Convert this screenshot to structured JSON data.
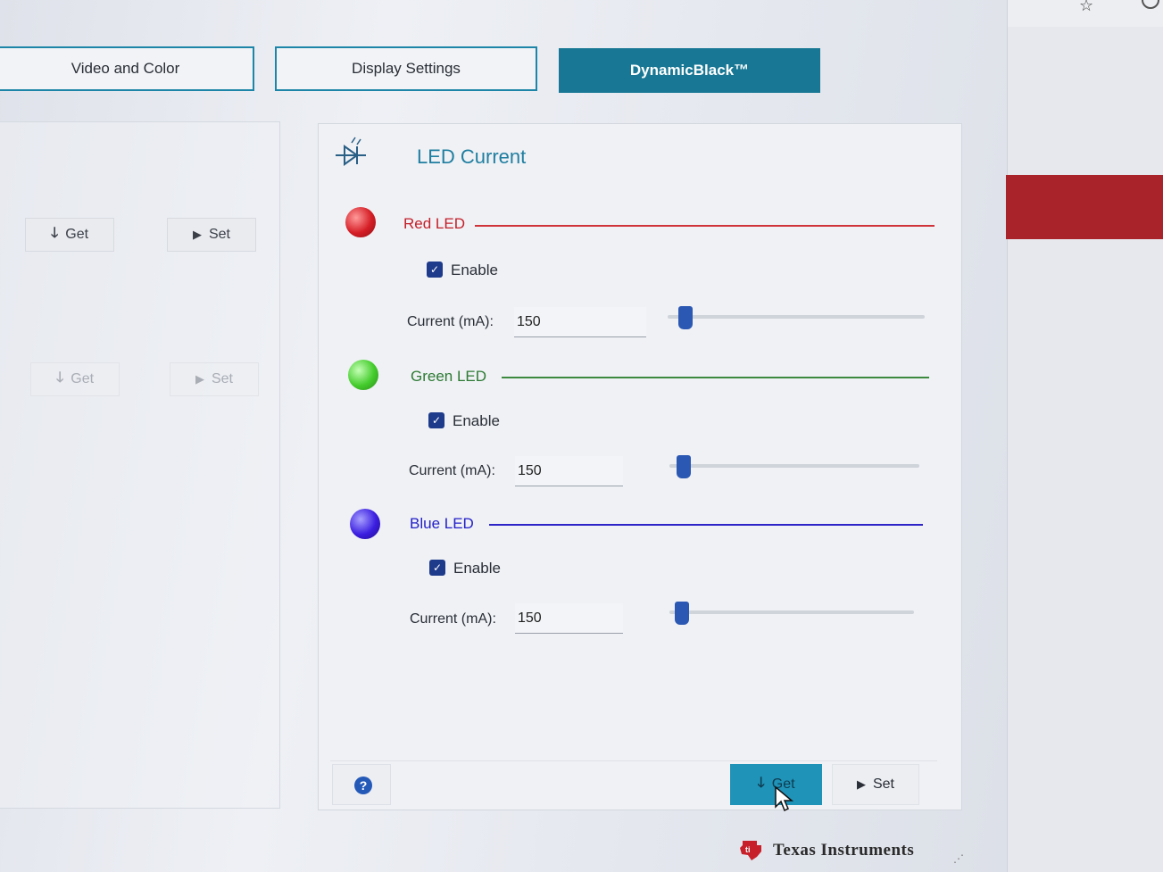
{
  "tabs": [
    {
      "label": "Video and Color",
      "active": false
    },
    {
      "label": "Display Settings",
      "active": false
    },
    {
      "label": "DynamicBlack™",
      "active": true
    }
  ],
  "left_panel": {
    "buttons": [
      {
        "label": "Get",
        "icon": "arrow-down-icon"
      },
      {
        "label": "Set",
        "icon": "play-icon"
      },
      {
        "label": "Get",
        "icon": "arrow-down-icon",
        "disabled": true
      },
      {
        "label": "Set",
        "icon": "play-icon",
        "disabled": true
      }
    ]
  },
  "led_panel": {
    "title": "LED Current",
    "title_icon": "led-diode-icon",
    "leds": [
      {
        "name": "Red LED",
        "color": "#c4202a",
        "enable_label": "Enable",
        "enabled": true,
        "current_label": "Current (mA):",
        "current_value": "150",
        "slider_level": 0.05
      },
      {
        "name": "Green LED",
        "color": "#2d7a33",
        "enable_label": "Enable",
        "enabled": true,
        "current_label": "Current (mA):",
        "current_value": "150",
        "slider_level": 0.05
      },
      {
        "name": "Blue LED",
        "color": "#2420c8",
        "enable_label": "Enable",
        "enabled": true,
        "current_label": "Current (mA):",
        "current_value": "150",
        "slider_level": 0.05
      }
    ],
    "footer": {
      "help_icon": "help-icon",
      "get_label": "Get",
      "set_label": "Set"
    }
  },
  "branding": {
    "company": "Texas Instruments",
    "logo": "ti-logo"
  },
  "accent_color": "#177794"
}
